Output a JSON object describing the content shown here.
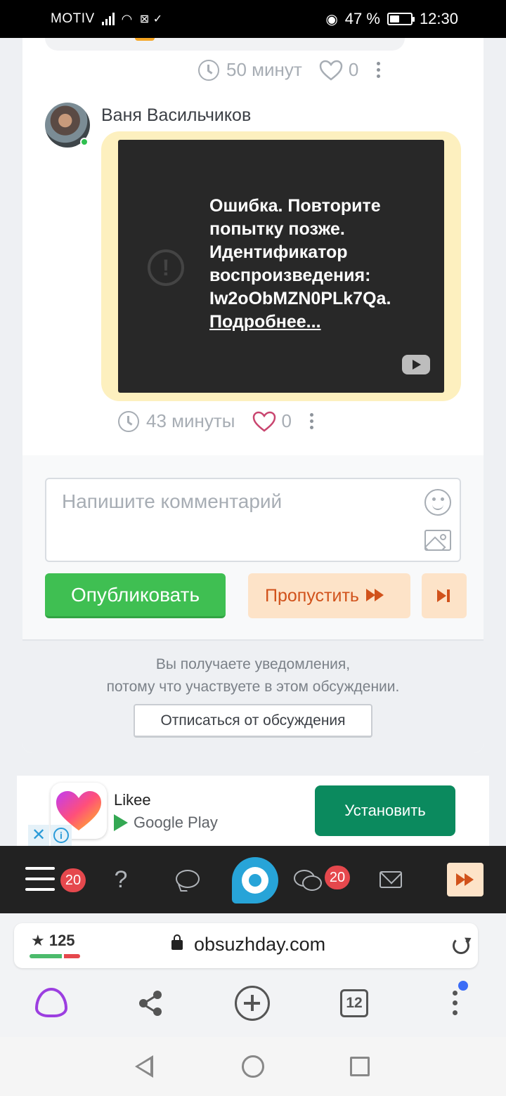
{
  "status_bar": {
    "carrier": "MOTIV",
    "battery": "47 %",
    "battery_level": 0.47,
    "time": "12:30"
  },
  "previous_message_meta": {
    "time": "50 минут",
    "likes": "0"
  },
  "message": {
    "author": "Ваня Васильчиков",
    "video_error": {
      "lines": [
        "Ошибка. Повторите",
        "попытку позже.",
        "Идентификатор",
        "воспроизведения:",
        "Iw2oObMZN0PLk7Qa."
      ],
      "link": "Подробнее..."
    },
    "time": "43 минуты",
    "likes": "0"
  },
  "comment_form": {
    "placeholder": "Напишите комментарий",
    "publish_label": "Опубликовать",
    "skip_label": "Пропустить"
  },
  "notice": {
    "line1": "Вы получаете уведомления,",
    "line2": "потому что участвуете в этом обсуждении.",
    "unsubscribe_label": "Отписаться от обсуждения"
  },
  "ad": {
    "app_name": "Likee",
    "store": "Google Play",
    "install_label": "Установить",
    "close_symbol": "✕",
    "info_symbol": "i"
  },
  "site_nav": {
    "menu_badge": "20",
    "chats_badge": "20",
    "help_symbol": "?"
  },
  "browser": {
    "rating": "★ 125",
    "domain": "obsuzhday.com",
    "tabs_count": "12"
  },
  "colors": {
    "publish": "#3fbf52",
    "skip_bg": "#fde3c8",
    "skip_text": "#d1521b",
    "bubble": "#fdf0bf",
    "badge": "#e5484d",
    "install": "#0b8a5e",
    "heart_active": "#c9456f"
  }
}
